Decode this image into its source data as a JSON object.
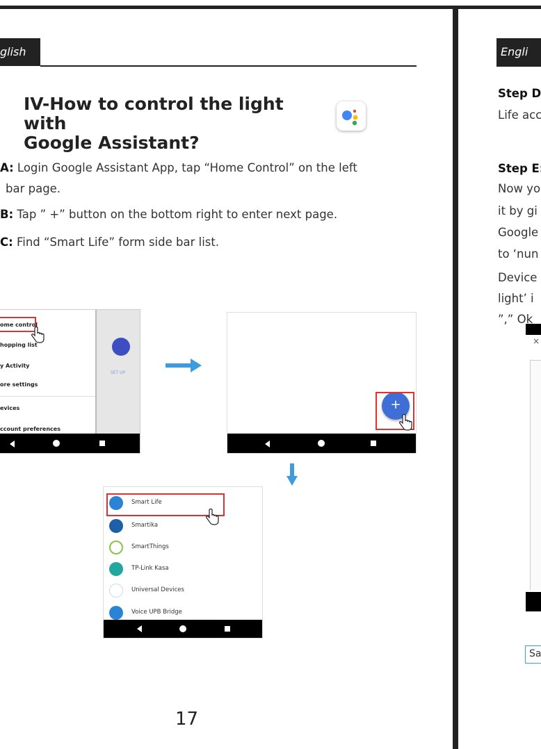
{
  "left_page": {
    "tag": "glish",
    "title_line1": "IV-How to control the light with",
    "title_line2": "Google Assistant?",
    "steps": [
      {
        "key": "A:",
        "text": " Login Google Assistant App, tap “Home Control” on the left"
      },
      {
        "key": "",
        "text": "bar page."
      },
      {
        "key": "B:",
        "text": " Tap ” +” button on the bottom right to enter next page."
      },
      {
        "key": "C:",
        "text": " Find  “Smart Life” form side bar list."
      }
    ],
    "menu_items": [
      "ome control",
      "hopping list",
      "y Activity",
      "ore settings",
      "evices",
      "ccount preferences"
    ],
    "setup_label": "SET UP",
    "fab_symbol": "+",
    "services": [
      "Smart Life",
      "Smartika",
      "SmartThings",
      "TP-Link Kasa",
      "Universal Devices",
      "Voice UPB Bridge"
    ],
    "page_number": "17"
  },
  "right_page": {
    "tag": "Engli",
    "lines": [
      "Step D",
      "Life acc",
      "Step E:",
      "Now yo",
      "it by gi",
      "Google",
      "to ‘nun",
      "Device",
      "light’  i",
      "”,” Ok"
    ],
    "close_symbol": "×",
    "caption": "Sa"
  },
  "colors": {
    "ink": "#222222",
    "red_highlight": "#e03030",
    "arrow_blue": "#3d9be0",
    "fab_blue": "#3f6fd6",
    "ga_blue": "#4285f4",
    "ga_red": "#ea4335",
    "ga_yellow": "#fbbc05",
    "ga_green": "#34a853",
    "caption_border": "#2aa8e0"
  }
}
